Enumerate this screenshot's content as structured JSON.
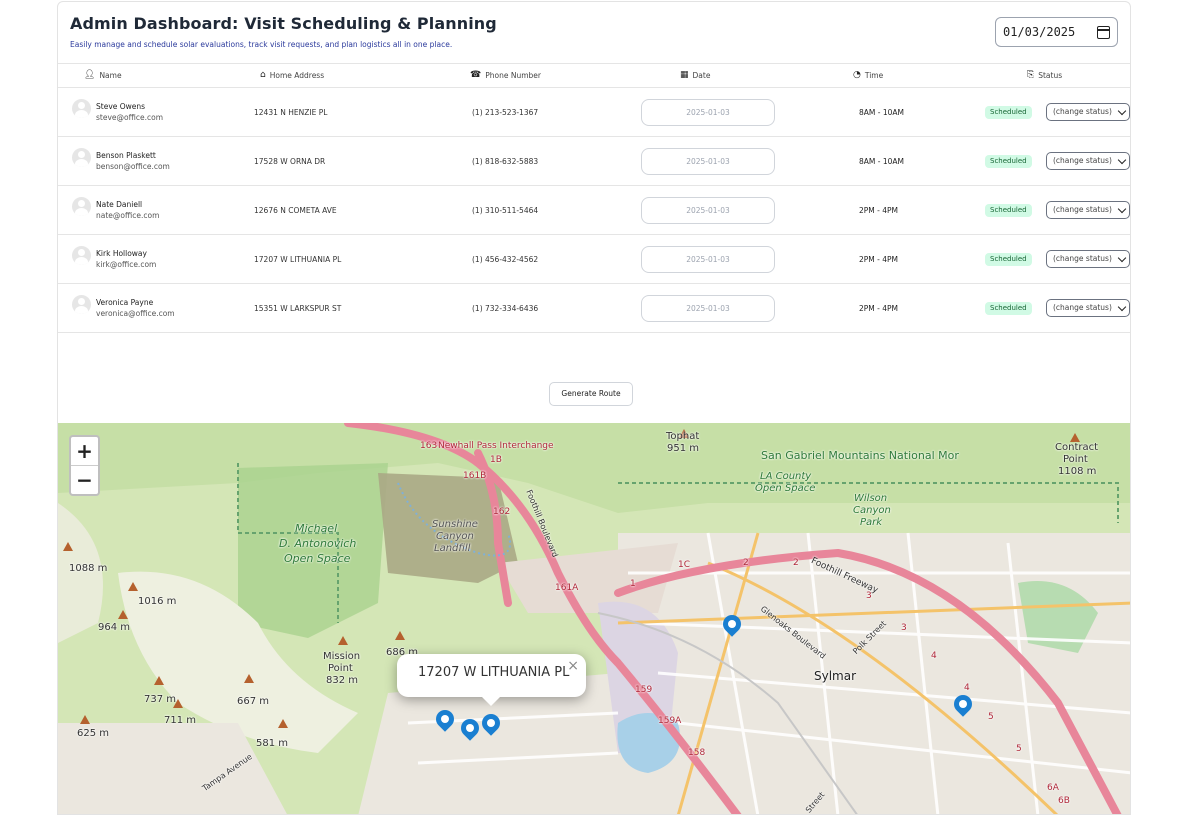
{
  "header": {
    "title": "Admin Dashboard: Visit Scheduling & Planning",
    "subtitle": "Easily manage and schedule solar evaluations, track visit requests, and plan logistics all in one place.",
    "date_value": "01/03/2025"
  },
  "columns": {
    "name": "Name",
    "address": "Home Address",
    "phone": "Phone Number",
    "date": "Date",
    "time": "Time",
    "status": "Status"
  },
  "rows": [
    {
      "name": "Steve Owens",
      "email": "steve@office.com",
      "address": "12431 N HENZIE PL",
      "phone": "(1) 213-523-1367",
      "date": "2025-01-03",
      "time": "8AM - 10AM",
      "status": "Scheduled",
      "change": "(change status)"
    },
    {
      "name": "Benson Plaskett",
      "email": "benson@office.com",
      "address": "17528 W ORNA DR",
      "phone": "(1) 818-632-5883",
      "date": "2025-01-03",
      "time": "8AM - 10AM",
      "status": "Scheduled",
      "change": "(change status)"
    },
    {
      "name": "Nate Daniell",
      "email": "nate@office.com",
      "address": "12676 N COMETA AVE",
      "phone": "(1) 310-511-5464",
      "date": "2025-01-03",
      "time": "2PM - 4PM",
      "status": "Scheduled",
      "change": "(change status)"
    },
    {
      "name": "Kirk Holloway",
      "email": "kirk@office.com",
      "address": "17207 W LITHUANIA PL",
      "phone": "(1) 456-432-4562",
      "date": "2025-01-03",
      "time": "2PM - 4PM",
      "status": "Scheduled",
      "change": "(change status)"
    },
    {
      "name": "Veronica Payne",
      "email": "veronica@office.com",
      "address": "15351 W LARKSPUR ST",
      "phone": "(1) 732-334-6436",
      "date": "2025-01-03",
      "time": "2PM - 4PM",
      "status": "Scheduled",
      "change": "(change status)"
    }
  ],
  "actions": {
    "generate_route": "Generate Route"
  },
  "map": {
    "zoom_in": "+",
    "zoom_out": "−",
    "popup_text": "17207 W LITHUANIA PL",
    "popup_close": "×",
    "labels": {
      "newhall": "Newhall Pass Interchange",
      "tophat": "Tophat",
      "tophat_elev": "951 m",
      "sgm": "San Gabriel Mountains National Mor",
      "contract": "Contract",
      "contract2": "Point",
      "contract_elev": "1108 m",
      "la_county": "LA County",
      "open_space": "Open Space",
      "wilson": "Wilson",
      "canyon": "Canyon",
      "park": "Park",
      "michael": "Michael",
      "antonovich": "D. Antonovich",
      "antonovich_os": "Open Space",
      "sunshine": "Sunshine",
      "sunshine2": "Canyon",
      "landfill": "Landfill",
      "e1088": "1088 m",
      "e1016": "1016 m",
      "e964": "964 m",
      "mission": "Mission",
      "mission2": "Point",
      "e832": "832 m",
      "e686": "686 m",
      "e737": "737 m",
      "e711": "711 m",
      "e667": "667 m",
      "e625": "625 m",
      "e581": "581 m",
      "sylmar": "Sylmar",
      "foothill_blvd": "Foothill Boulevard",
      "foothill_fwy": "Foothill Freeway",
      "glenoaks": "Glenoaks Boulevard",
      "polk": "Polk Street",
      "tampa": "Tampa Avenue",
      "street": "Street",
      "r163": "163",
      "r161b": "161B",
      "r162": "162",
      "r161a": "161A",
      "r159": "159",
      "r159a": "159A",
      "r158": "158",
      "r1b": "1B",
      "r1c": "1C",
      "r1": "1",
      "r2a": "2",
      "r2b": "2",
      "r3a": "3",
      "r3b": "3",
      "r4a": "4",
      "r4b": "4",
      "r5a": "5",
      "r5b": "5",
      "r6a": "6A",
      "r6b": "6B"
    }
  }
}
